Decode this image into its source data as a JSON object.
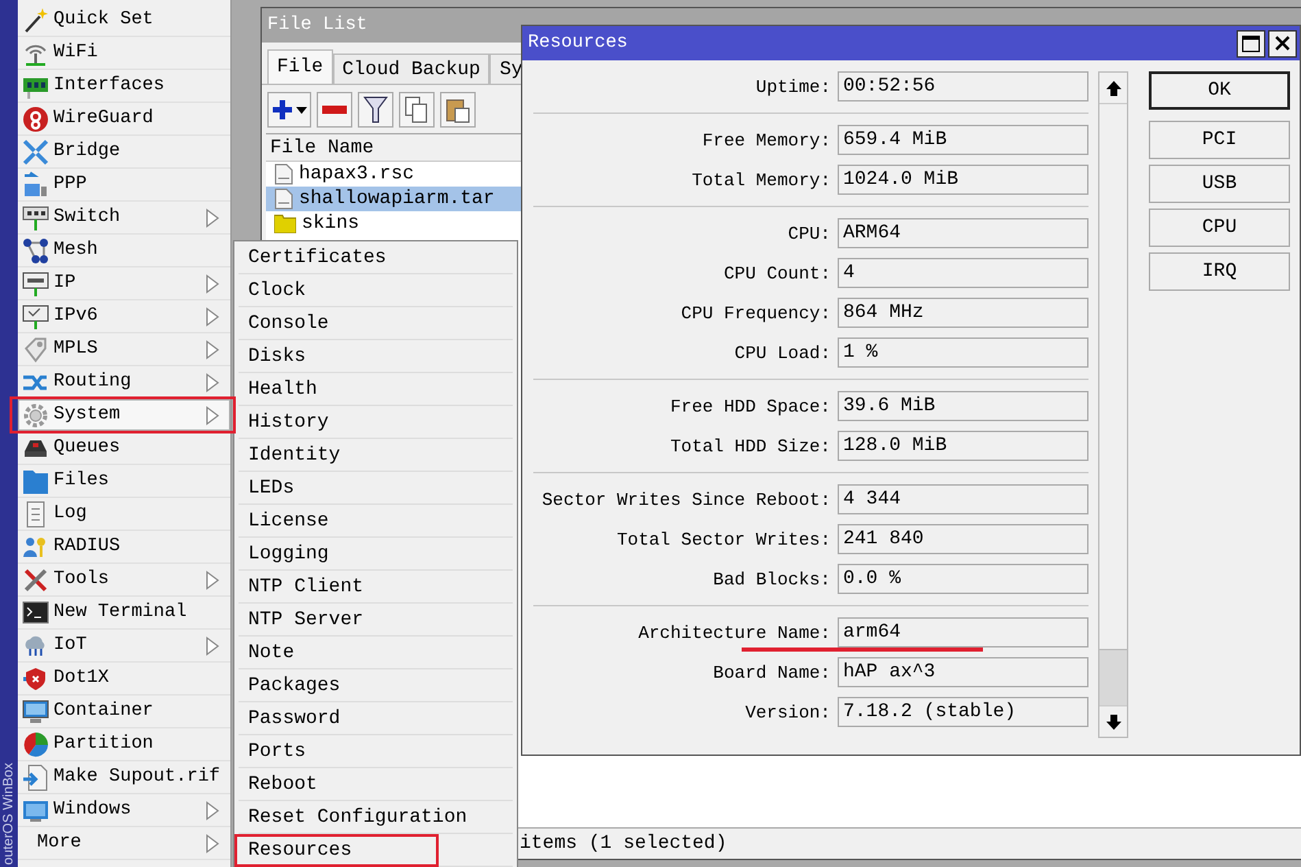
{
  "sidebar": {
    "brand": "outerOS WinBox",
    "items": [
      {
        "label": "Quick Set",
        "submenu": false,
        "selected": false,
        "highlighted": false
      },
      {
        "label": "WiFi",
        "submenu": false,
        "selected": false,
        "highlighted": false
      },
      {
        "label": "Interfaces",
        "submenu": false,
        "selected": false,
        "highlighted": false
      },
      {
        "label": "WireGuard",
        "submenu": false,
        "selected": false,
        "highlighted": false
      },
      {
        "label": "Bridge",
        "submenu": false,
        "selected": false,
        "highlighted": false
      },
      {
        "label": "PPP",
        "submenu": false,
        "selected": false,
        "highlighted": false
      },
      {
        "label": "Switch",
        "submenu": true,
        "selected": false,
        "highlighted": false
      },
      {
        "label": "Mesh",
        "submenu": false,
        "selected": false,
        "highlighted": false
      },
      {
        "label": "IP",
        "submenu": true,
        "selected": false,
        "highlighted": false
      },
      {
        "label": "IPv6",
        "submenu": true,
        "selected": false,
        "highlighted": false
      },
      {
        "label": "MPLS",
        "submenu": true,
        "selected": false,
        "highlighted": false
      },
      {
        "label": "Routing",
        "submenu": true,
        "selected": false,
        "highlighted": false
      },
      {
        "label": "System",
        "submenu": true,
        "selected": true,
        "highlighted": true
      },
      {
        "label": "Queues",
        "submenu": false,
        "selected": false,
        "highlighted": false
      },
      {
        "label": "Files",
        "submenu": false,
        "selected": false,
        "highlighted": false
      },
      {
        "label": "Log",
        "submenu": false,
        "selected": false,
        "highlighted": false
      },
      {
        "label": "RADIUS",
        "submenu": false,
        "selected": false,
        "highlighted": false
      },
      {
        "label": "Tools",
        "submenu": true,
        "selected": false,
        "highlighted": false
      },
      {
        "label": "New Terminal",
        "submenu": false,
        "selected": false,
        "highlighted": false
      },
      {
        "label": "IoT",
        "submenu": true,
        "selected": false,
        "highlighted": false
      },
      {
        "label": "Dot1X",
        "submenu": false,
        "selected": false,
        "highlighted": false
      },
      {
        "label": "Container",
        "submenu": false,
        "selected": false,
        "highlighted": false
      },
      {
        "label": "Partition",
        "submenu": false,
        "selected": false,
        "highlighted": false
      },
      {
        "label": "Make Supout.rif",
        "submenu": false,
        "selected": false,
        "highlighted": false
      },
      {
        "label": "Windows",
        "submenu": true,
        "selected": false,
        "highlighted": false
      },
      {
        "label": "More",
        "submenu": true,
        "selected": false,
        "highlighted": false
      }
    ]
  },
  "file_list": {
    "title": "File List",
    "tabs": [
      {
        "label": "File",
        "selected": true
      },
      {
        "label": "Cloud Backup",
        "selected": false
      },
      {
        "label": "Sy",
        "selected": false
      }
    ],
    "columns": [
      "File Name"
    ],
    "rows": [
      {
        "name": "hapax3.rsc",
        "kind": "file",
        "selected": false
      },
      {
        "name": "shallowapiarm.tar",
        "kind": "file",
        "selected": true
      },
      {
        "name": "skins",
        "kind": "folder",
        "selected": false
      }
    ],
    "status": "items (1 selected)"
  },
  "system_menu": {
    "items": [
      {
        "label": "Certificates",
        "highlighted": false
      },
      {
        "label": "Clock",
        "highlighted": false
      },
      {
        "label": "Console",
        "highlighted": false
      },
      {
        "label": "Disks",
        "highlighted": false
      },
      {
        "label": "Health",
        "highlighted": false
      },
      {
        "label": "History",
        "highlighted": false
      },
      {
        "label": "Identity",
        "highlighted": false
      },
      {
        "label": "LEDs",
        "highlighted": false
      },
      {
        "label": "License",
        "highlighted": false
      },
      {
        "label": "Logging",
        "highlighted": false
      },
      {
        "label": "NTP Client",
        "highlighted": false
      },
      {
        "label": "NTP Server",
        "highlighted": false
      },
      {
        "label": "Note",
        "highlighted": false
      },
      {
        "label": "Packages",
        "highlighted": false
      },
      {
        "label": "Password",
        "highlighted": false
      },
      {
        "label": "Ports",
        "highlighted": false
      },
      {
        "label": "Reboot",
        "highlighted": false
      },
      {
        "label": "Reset Configuration",
        "highlighted": false
      },
      {
        "label": "Resources",
        "highlighted": true
      }
    ]
  },
  "resources": {
    "title": "Resources",
    "groups": [
      [
        {
          "label": "Uptime:",
          "value": "00:52:56",
          "underlined": false
        }
      ],
      [
        {
          "label": "Free Memory:",
          "value": "659.4 MiB",
          "underlined": false
        },
        {
          "label": "Total Memory:",
          "value": "1024.0 MiB",
          "underlined": false
        }
      ],
      [
        {
          "label": "CPU:",
          "value": "ARM64",
          "underlined": false
        },
        {
          "label": "CPU Count:",
          "value": "4",
          "underlined": false
        },
        {
          "label": "CPU Frequency:",
          "value": "864 MHz",
          "underlined": false
        },
        {
          "label": "CPU Load:",
          "value": "1 %",
          "underlined": false
        }
      ],
      [
        {
          "label": "Free HDD Space:",
          "value": "39.6 MiB",
          "underlined": false
        },
        {
          "label": "Total HDD Size:",
          "value": "128.0 MiB",
          "underlined": false
        }
      ],
      [
        {
          "label": "Sector Writes Since Reboot:",
          "value": "4 344",
          "underlined": false
        },
        {
          "label": "Total Sector Writes:",
          "value": "241 840",
          "underlined": false
        },
        {
          "label": "Bad Blocks:",
          "value": "0.0 %",
          "underlined": false
        }
      ],
      [
        {
          "label": "Architecture Name:",
          "value": "arm64",
          "underlined": true
        },
        {
          "label": "Board Name:",
          "value": "hAP ax^3",
          "underlined": false
        },
        {
          "label": "Version:",
          "value": "7.18.2 (stable)",
          "underlined": false
        }
      ]
    ],
    "buttons": [
      {
        "label": "OK",
        "default": true
      },
      {
        "label": "PCI",
        "default": false
      },
      {
        "label": "USB",
        "default": false
      },
      {
        "label": "CPU",
        "default": false
      },
      {
        "label": "IRQ",
        "default": false
      }
    ]
  }
}
